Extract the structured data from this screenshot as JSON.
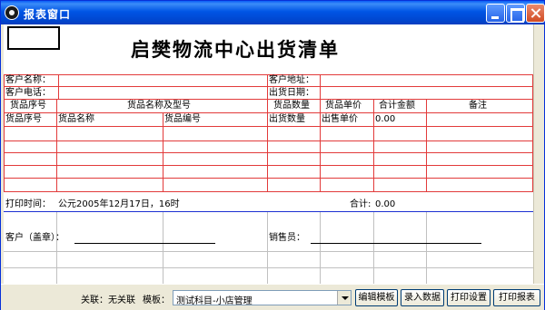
{
  "window": {
    "title": "报表窗口"
  },
  "report": {
    "title": "启樊物流中心出货清单",
    "labels": {
      "customer_name": "客户名称：",
      "customer_address": "客户地址：",
      "customer_phone": "客户电话：",
      "ship_date": "出货日期：",
      "col_seq": "货品序号",
      "col_name_model": "货品名称及型号",
      "col_qty": "货品数量",
      "col_unit_price": "货品单价",
      "col_total": "合计金额",
      "col_note": "备注",
      "sub_seq": "货品序号",
      "sub_name": "货品名称",
      "sub_code": "货品编号",
      "sub_qty": "出货数量",
      "sub_price": "出售单价",
      "print_time": "打印时间：",
      "sum": "合计:",
      "customer_seal": "客户（盖章）：",
      "salesperson": "销售员："
    },
    "values": {
      "row_total": "0.00",
      "print_time": "公元2005年12月17日，16时",
      "sum": "0.00"
    }
  },
  "status": {
    "link_label": "关联：无关联",
    "template_label": "模板：",
    "template_value": "测试科目-小店管理",
    "buttons": {
      "edit_template": "编辑模板",
      "input_data": "录入数据",
      "print_settings": "打印设置",
      "print_report": "打印报表"
    }
  }
}
